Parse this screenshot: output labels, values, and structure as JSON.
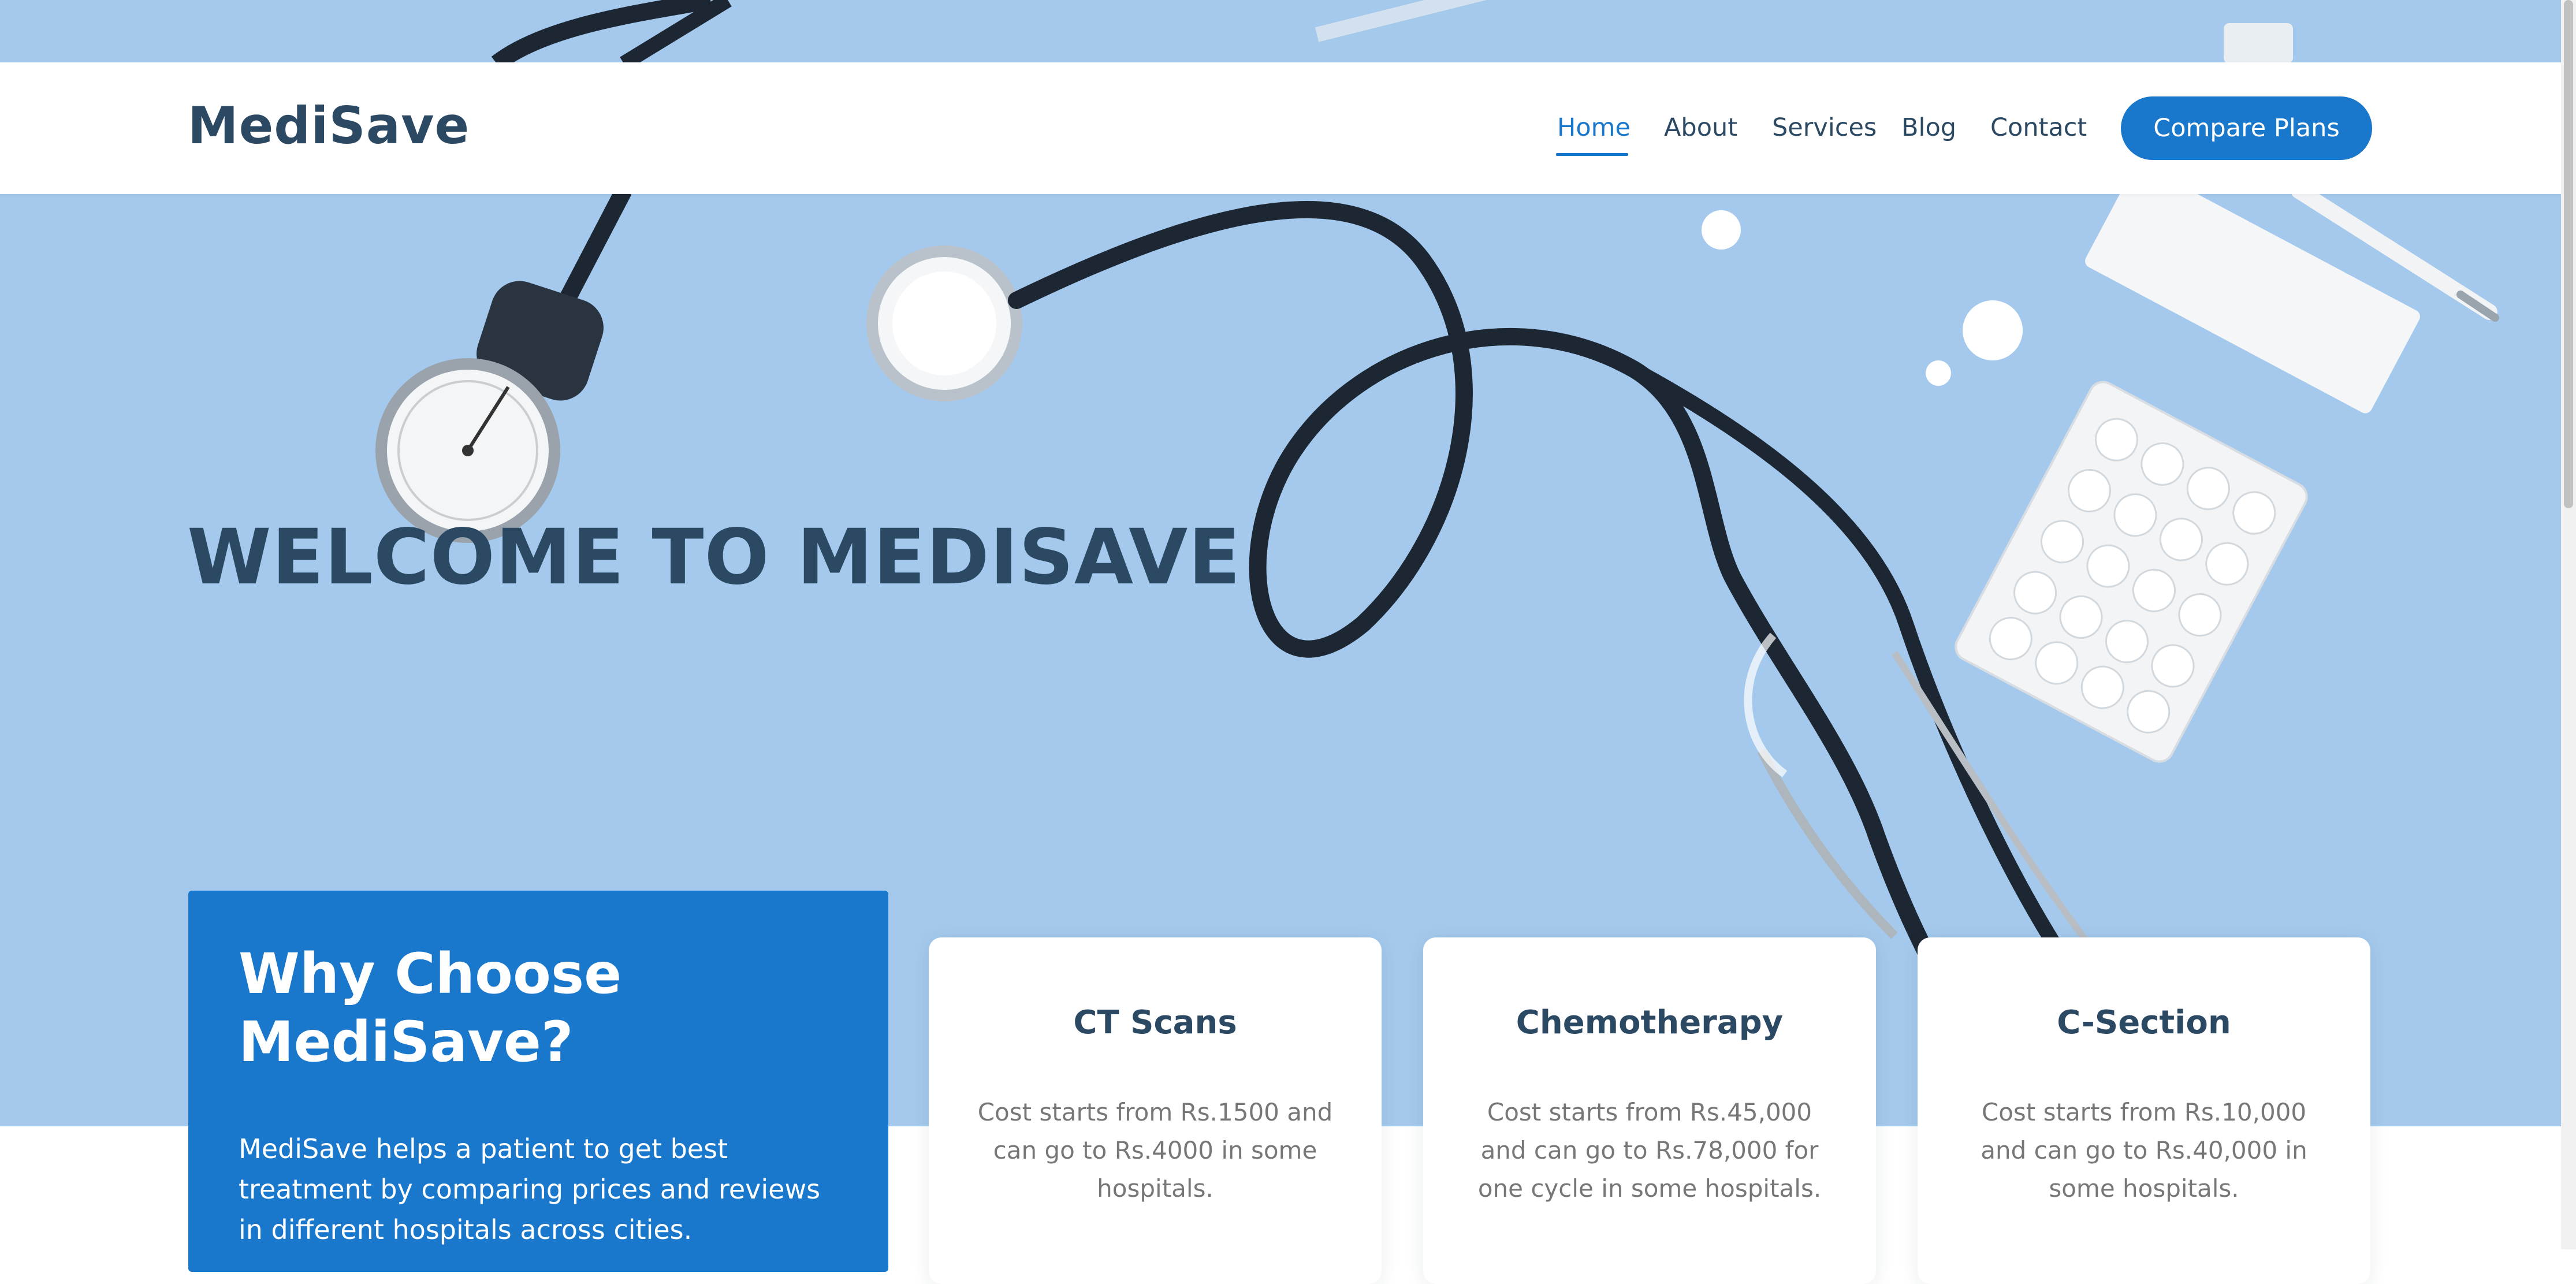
{
  "brand": {
    "name": "MediSave"
  },
  "nav": {
    "items": [
      {
        "label": "Home",
        "active": true
      },
      {
        "label": "About",
        "active": false
      },
      {
        "label": "Services",
        "active": false
      },
      {
        "label": "Blog",
        "active": false
      },
      {
        "label": "Contact",
        "active": false
      }
    ],
    "cta_label": "Compare Plans"
  },
  "hero": {
    "title": "WELCOME TO MEDISAVE"
  },
  "why": {
    "title": "Why Choose MediSave?",
    "text": "MediSave helps a patient to get best treatment by comparing prices and reviews in different hospitals across cities."
  },
  "services": [
    {
      "title": "CT Scans",
      "text": "Cost starts from Rs.1500 and can go to Rs.4000 in some hospitals."
    },
    {
      "title": "Chemotherapy",
      "text": "Cost starts from Rs.45,000 and can go to Rs.78,000 for one cycle in some hospitals."
    },
    {
      "title": "C-Section",
      "text": "Cost starts from Rs.10,000 and can go to Rs.40,000 in some hospitals."
    }
  ],
  "colors": {
    "brand_blue": "#1977cc",
    "heading_navy": "#2c4964",
    "hero_bg": "#a4c9ec"
  }
}
